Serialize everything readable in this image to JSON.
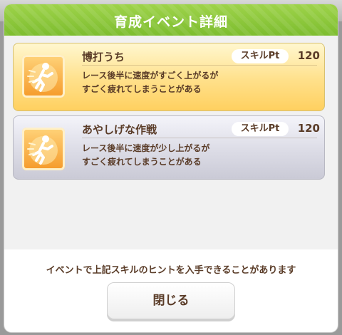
{
  "dialog": {
    "title": "育成イベント詳細",
    "hint": "イベントで上記スキルのヒントを入手できることがあります",
    "close_label": "閉じる"
  },
  "skills": [
    {
      "name": "博打うち",
      "pt_label": "スキルPt",
      "pt_value": "120",
      "desc_line1": "レース後半に速度がすごく上がるが",
      "desc_line2": "すごく疲れてしまうことがある",
      "icon": "sprinting-figure-icon",
      "rarity_color": "#ffd060"
    },
    {
      "name": "あやしげな作戦",
      "pt_label": "スキルPt",
      "pt_value": "120",
      "desc_line1": "レース後半に速度が少し上がるが",
      "desc_line2": "すごく疲れてしまうことがある",
      "icon": "sprinting-figure-icon",
      "rarity_color": "#cacad6"
    }
  ],
  "colors": {
    "header": "#8cc63f",
    "text": "#5a3c28"
  }
}
